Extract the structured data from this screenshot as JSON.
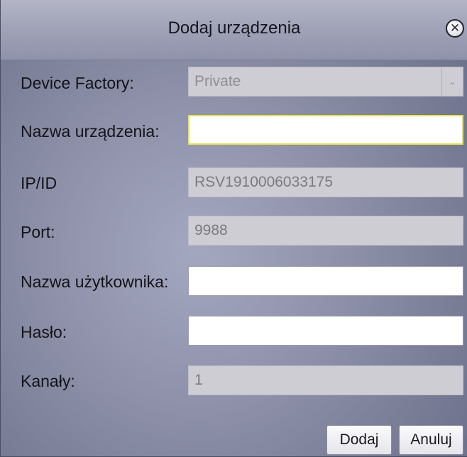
{
  "dialog": {
    "title": "Dodaj urządzenia",
    "close_icon": "close-icon",
    "close_glyph": "✕"
  },
  "form": {
    "device_factory": {
      "label": "Device Factory:",
      "value": "Private",
      "arrow": "⌄"
    },
    "device_name": {
      "label": "Nazwa urządzenia:",
      "value": ""
    },
    "ip_id": {
      "label": "IP/ID",
      "value": "RSV1910006033175"
    },
    "port": {
      "label": "Port:",
      "value": "9988"
    },
    "username": {
      "label": "Nazwa użytkownika:",
      "value": ""
    },
    "password": {
      "label": "Hasło:",
      "value": ""
    },
    "channels": {
      "label": "Kanały:",
      "value": "1"
    }
  },
  "buttons": {
    "add": "Dodaj",
    "cancel": "Anuluj"
  },
  "colors": {
    "background": "#9a9db5",
    "focus_border": "#e8e24e",
    "disabled_field": "#cdcdd3"
  }
}
